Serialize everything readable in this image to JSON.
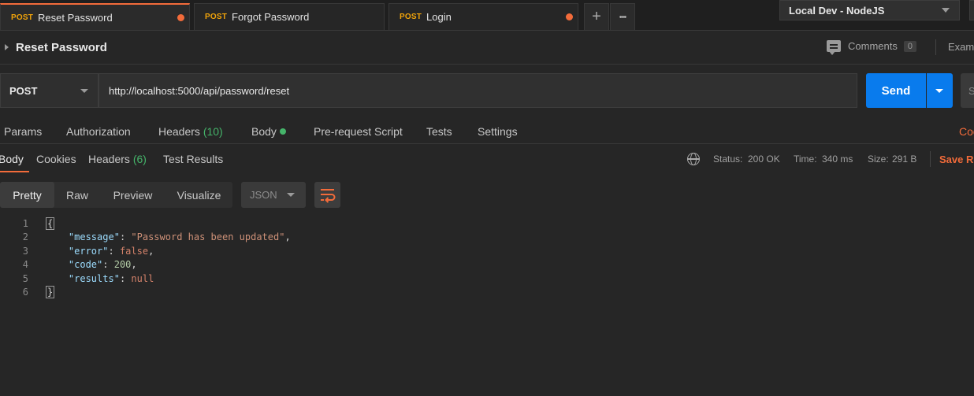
{
  "tabs": [
    {
      "method": "POST",
      "name": "Reset Password",
      "active": true,
      "unsaved": true
    },
    {
      "method": "POST",
      "name": "Forgot Password",
      "active": false,
      "unsaved": false
    },
    {
      "method": "POST",
      "name": "Login",
      "active": false,
      "unsaved": true
    }
  ],
  "tabbar": {
    "add_icon": "+",
    "more_icon": "•••"
  },
  "environment": {
    "selected": "Local Dev - NodeJS"
  },
  "request": {
    "name": "Reset Password",
    "method": "POST",
    "url": "http://localhost:5000/api/password/reset",
    "send_label": "Send",
    "save_partial": "S"
  },
  "comments": {
    "label": "Comments",
    "count": "0"
  },
  "examples_partial": "Exam",
  "request_tabs": {
    "params": "Params",
    "authorization": "Authorization",
    "headers": "Headers",
    "headers_count": "(10)",
    "body": "Body",
    "prerequest": "Pre-request Script",
    "tests": "Tests",
    "settings": "Settings",
    "code_partial": "Coo"
  },
  "response_tabs": {
    "body": "Body",
    "cookies": "Cookies",
    "headers": "Headers",
    "headers_count": "(6)",
    "test_results": "Test Results"
  },
  "response_status": {
    "status_label": "Status:",
    "status_value": "200 OK",
    "time_label": "Time:",
    "time_value": "340 ms",
    "size_label": "Size:",
    "size_value": "291 B",
    "save_partial": "Save Re"
  },
  "format": {
    "modes": [
      "Pretty",
      "Raw",
      "Preview",
      "Visualize"
    ],
    "selected": "Pretty",
    "language": "JSON"
  },
  "response_body": {
    "line_numbers": [
      "1",
      "2",
      "3",
      "4",
      "5",
      "6"
    ],
    "open_brace": "{",
    "close_brace": "}",
    "message_key": "\"message\"",
    "message_value": "\"Password has been updated\"",
    "error_key": "\"error\"",
    "error_value": "false",
    "code_key": "\"code\"",
    "code_value": "200",
    "results_key": "\"results\"",
    "results_value": "null"
  },
  "colors": {
    "accent": "#f26b3a",
    "send_button": "#097bed",
    "method_post": "#f0a30a",
    "status_ok": "#45b46a"
  }
}
